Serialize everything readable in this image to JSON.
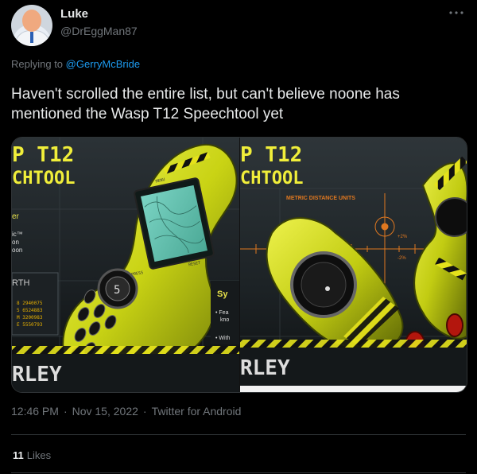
{
  "author": {
    "display_name": "Luke",
    "handle": "@DrEggMan87"
  },
  "reply": {
    "prefix": "Replying to",
    "mention": "@GerryMcBride"
  },
  "tweet_text": "Haven't scrolled the entire list, but can't believe noone has mentioned the Wasp T12 Speechtool yet",
  "media": {
    "left_title_line1": "P T12",
    "left_title_line2": "CHTOOL",
    "left_side_text": [
      "er",
      "ic™",
      "on",
      "oon"
    ],
    "left_rth": "RTH",
    "left_list": [
      "8  2940075",
      "5  6524883",
      "M  3200983",
      "E  5550793"
    ],
    "left_device_labels": [
      "MENU",
      "PRESS",
      "RESET"
    ],
    "left_sy": "Sy",
    "left_bullets": [
      "• Fea",
      "kno",
      "• With"
    ],
    "left_footer": "RLEY",
    "right_title_line1": "P T12",
    "right_title_line2": "CHTOOL",
    "right_units": "METRIC DISTANCE UNITS",
    "right_plus": "+2%",
    "right_minus": "-2%",
    "right_footer": "RLEY"
  },
  "meta": {
    "time": "12:46 PM",
    "date": "Nov 15, 2022",
    "source": "Twitter for Android"
  },
  "stats": {
    "likes_count": "11",
    "likes_label": "Likes"
  },
  "colors": {
    "background": "#000000",
    "accent": "#1d9bf0",
    "muted": "#71767b",
    "device_yellow": "#d9e21a"
  }
}
